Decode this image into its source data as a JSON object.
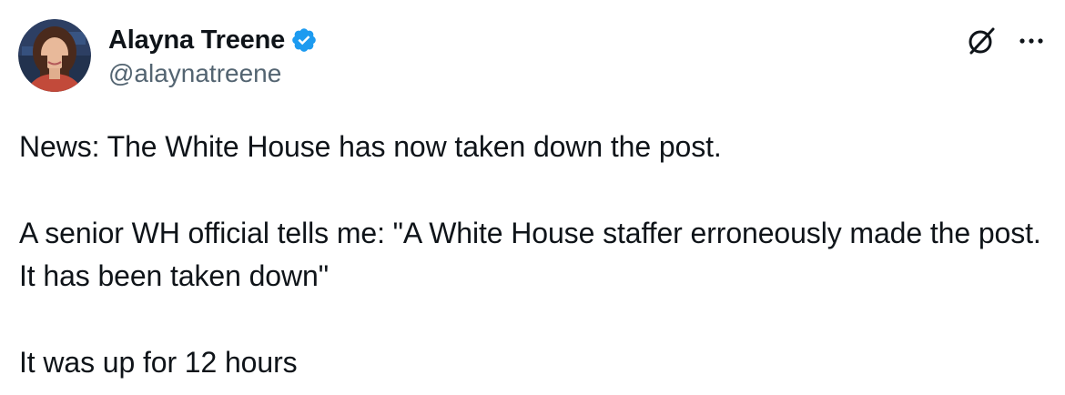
{
  "author": {
    "display_name": "Alayna Treene",
    "handle": "@alaynatreene",
    "verified": true
  },
  "icons": {
    "verified": "verified-badge-icon",
    "grok": "grok-icon",
    "more": "more-options-icon"
  },
  "colors": {
    "text": "#0f1419",
    "secondary_text": "#536471",
    "verified_blue": "#1d9bf0"
  },
  "tweet": {
    "paragraphs": [
      "News: The White House has now taken down the post.",
      "A senior WH official tells me: \"A White House staffer erroneously made the post. It has been taken down\"",
      "It was up for 12 hours"
    ]
  }
}
